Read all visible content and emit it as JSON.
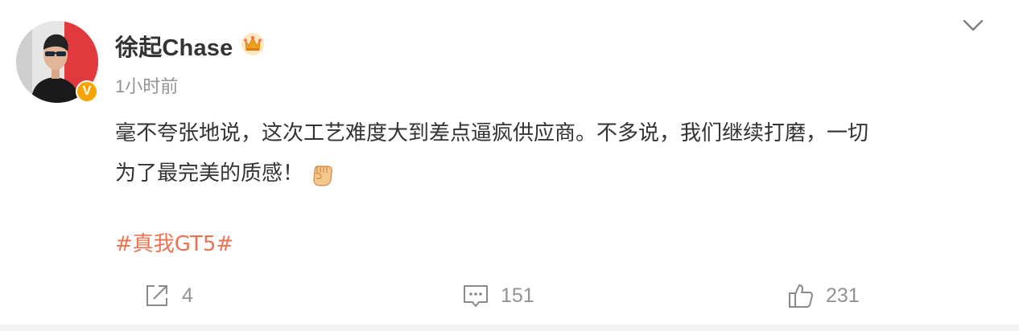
{
  "post": {
    "author": "徐起Chase",
    "timestamp": "1小时前",
    "text_lines": [
      "毫不夸张地说，这次工艺难度大到差点逼疯供应商。不多说，我们继续打磨，一切",
      "为了最完美的质感！"
    ],
    "hashtag": "#真我GT5#",
    "emoji": "fist-emoji"
  },
  "actions": {
    "repost_count": "4",
    "comment_count": "151",
    "like_count": "231"
  },
  "colors": {
    "text": "#333333",
    "meta": "#939393",
    "hashtag": "#eb7350",
    "verified": "#f6a400"
  },
  "icons": [
    "repost-icon",
    "comment-icon",
    "like-icon",
    "chevron-down-icon",
    "crown-icon",
    "verified-icon"
  ]
}
